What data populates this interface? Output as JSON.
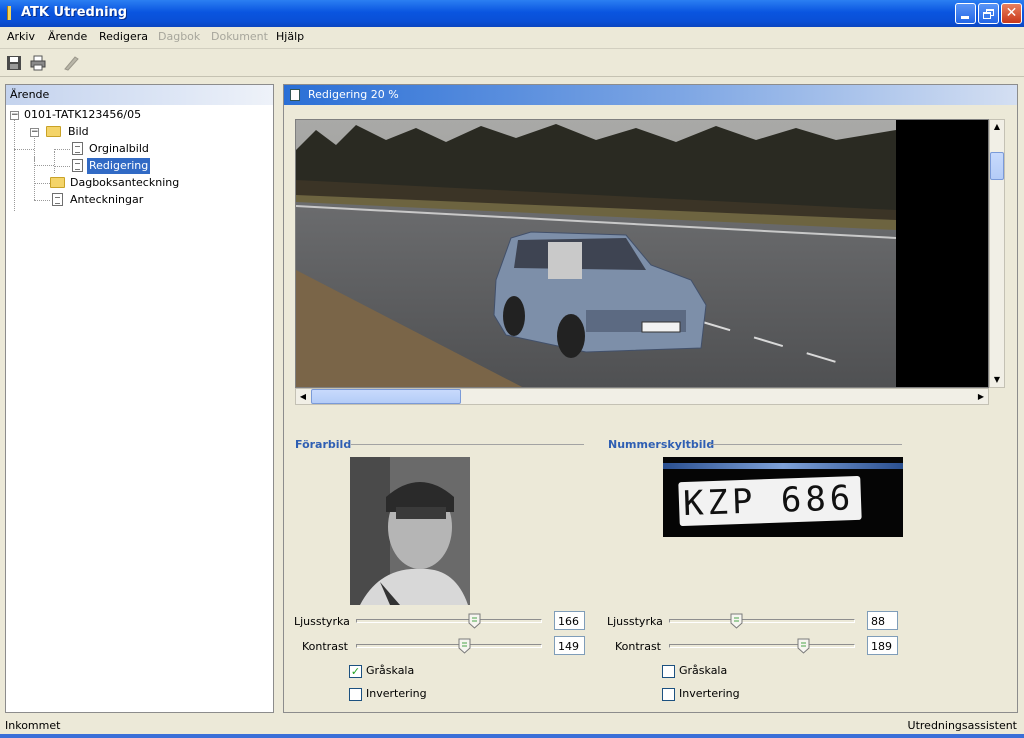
{
  "window": {
    "title": "ATK Utredning"
  },
  "menu": [
    {
      "label": "Arkiv",
      "enabled": true
    },
    {
      "label": "Ärende",
      "enabled": true
    },
    {
      "label": "Redigera",
      "enabled": true
    },
    {
      "label": "Dagbok",
      "enabled": false
    },
    {
      "label": "Dokument",
      "enabled": false
    },
    {
      "label": "Hjälp",
      "enabled": true
    }
  ],
  "toolbar": {
    "icons": [
      "save-icon",
      "print-icon",
      "edit-icon"
    ]
  },
  "left_panel": {
    "title": "Ärende",
    "tree": {
      "root": "0101-TATK123456/05",
      "bild": "Bild",
      "orginalbild": "Orginalbild",
      "redigering": "Redigering",
      "dagboksanteckning": "Dagboksanteckning",
      "anteckningar": "Anteckningar"
    }
  },
  "right_panel": {
    "title": "Redigering 20 %",
    "plate_text": "KZP 686",
    "forarbild": {
      "title": "Förarbild",
      "ljusstyrka_label": "Ljusstyrka",
      "ljusstyrka": "166",
      "ljusstyrka_fraction": 0.65,
      "kontrast_label": "Kontrast",
      "kontrast": "149",
      "kontrast_fraction": 0.59,
      "graskala_label": "Gråskala",
      "graskala_checked": true,
      "invertering_label": "Invertering",
      "invertering_checked": false
    },
    "nummerskyltbild": {
      "title": "Nummerskyltbild",
      "ljusstyrka_label": "Ljusstyrka",
      "ljusstyrka": "88",
      "ljusstyrka_fraction": 0.35,
      "kontrast_label": "Kontrast",
      "kontrast": "189",
      "kontrast_fraction": 0.74,
      "graskala_label": "Gråskala",
      "graskala_checked": false,
      "invertering_label": "Invertering",
      "invertering_checked": false
    }
  },
  "status": {
    "left": "Inkommet",
    "right": "Utredningsassistent"
  }
}
